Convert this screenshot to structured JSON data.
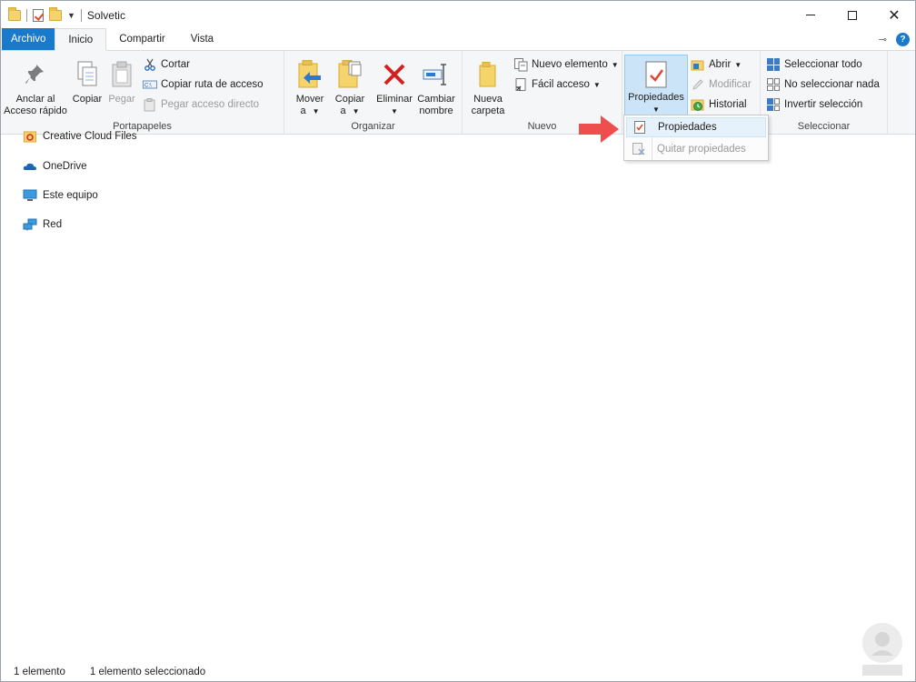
{
  "window": {
    "title": "Solvetic"
  },
  "tabs": [
    {
      "label": "Archivo"
    },
    {
      "label": "Inicio"
    },
    {
      "label": "Compartir"
    },
    {
      "label": "Vista"
    }
  ],
  "ribbon": {
    "portapapeles": {
      "anclar": "Anclar al",
      "anclar2": "Acceso rápido",
      "copiar": "Copiar",
      "pegar": "Pegar",
      "cortar": "Cortar",
      "copiar_ruta": "Copiar ruta de acceso",
      "pegar_acceso": "Pegar acceso directo",
      "label": "Portapapeles"
    },
    "organizar": {
      "mover": "Mover",
      "mover2": "a",
      "copiar": "Copiar",
      "copiar2": "a",
      "eliminar": "Eliminar",
      "cambiar": "Cambiar",
      "cambiar2": "nombre",
      "label": "Organizar"
    },
    "nuevo": {
      "nueva": "Nueva",
      "carpeta": "carpeta",
      "nuevo_elemento": "Nuevo elemento",
      "facil_acceso": "Fácil acceso",
      "label": "Nuevo"
    },
    "abrir": {
      "propiedades": "Propiedades",
      "abrir": "Abrir",
      "modificar": "Modificar",
      "historial": "Historial"
    },
    "seleccionar": {
      "todo": "Seleccionar todo",
      "nada": "No seleccionar nada",
      "invertir": "Invertir selección",
      "label": "Seleccionar"
    }
  },
  "dropdown": {
    "propiedades": "Propiedades",
    "quitar": "Quitar propiedades"
  },
  "nav": {
    "items": [
      {
        "label": "Creative Cloud Files",
        "icon": "creative-cloud-icon"
      },
      {
        "label": "OneDrive",
        "icon": "onedrive-icon"
      },
      {
        "label": "Este equipo",
        "icon": "computer-icon"
      },
      {
        "label": "Red",
        "icon": "network-icon"
      }
    ]
  },
  "status": {
    "count": "1 elemento",
    "selected": "1 elemento seleccionado"
  },
  "colors": {
    "accent": "#1979ca",
    "arrow": "#ee4e4e"
  }
}
